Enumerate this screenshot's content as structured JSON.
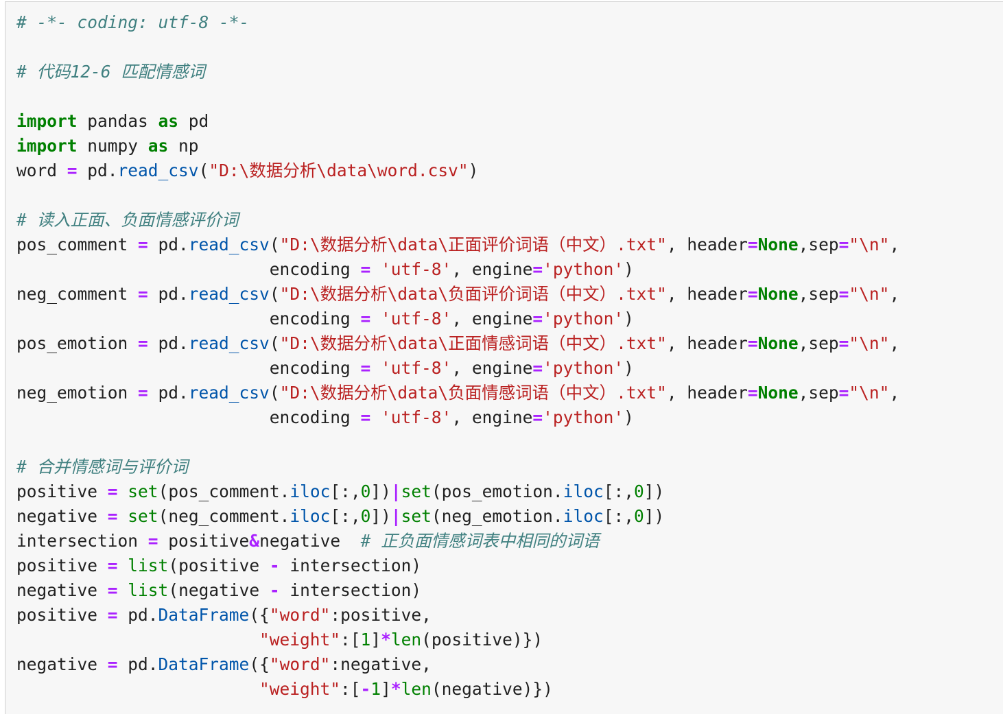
{
  "cell": {
    "lines": [
      [
        [
          "c",
          "# -*- coding: utf-8 -*-"
        ]
      ],
      [],
      [
        [
          "c",
          "# 代码12-6 匹配情感词"
        ]
      ],
      [],
      [
        [
          "k",
          "import"
        ],
        [
          "t",
          " pandas "
        ],
        [
          "k",
          "as"
        ],
        [
          "t",
          " pd"
        ]
      ],
      [
        [
          "k",
          "import"
        ],
        [
          "t",
          " numpy "
        ],
        [
          "k",
          "as"
        ],
        [
          "t",
          " np"
        ]
      ],
      [
        [
          "t",
          "word "
        ],
        [
          "o",
          "="
        ],
        [
          "t",
          " pd."
        ],
        [
          "f",
          "read_csv"
        ],
        [
          "t",
          "("
        ],
        [
          "s",
          "\"D:\\数据分析\\data\\word.csv\""
        ],
        [
          "t",
          ")"
        ]
      ],
      [],
      [
        [
          "c",
          "# 读入正面、负面情感评价词"
        ]
      ],
      [
        [
          "t",
          "pos_comment "
        ],
        [
          "o",
          "="
        ],
        [
          "t",
          " pd."
        ],
        [
          "f",
          "read_csv"
        ],
        [
          "t",
          "("
        ],
        [
          "s",
          "\"D:\\数据分析\\data\\正面评价词语（中文）.txt\""
        ],
        [
          "t",
          ", header"
        ],
        [
          "o",
          "="
        ],
        [
          "k",
          "None"
        ],
        [
          "t",
          ",sep"
        ],
        [
          "o",
          "="
        ],
        [
          "s",
          "\"\\n\""
        ],
        [
          "t",
          ","
        ]
      ],
      [
        [
          "t",
          "                         encoding "
        ],
        [
          "o",
          "="
        ],
        [
          "t",
          " "
        ],
        [
          "s",
          "'utf-8'"
        ],
        [
          "t",
          ", engine"
        ],
        [
          "o",
          "="
        ],
        [
          "s",
          "'python'"
        ],
        [
          "t",
          ")"
        ]
      ],
      [
        [
          "t",
          "neg_comment "
        ],
        [
          "o",
          "="
        ],
        [
          "t",
          " pd."
        ],
        [
          "f",
          "read_csv"
        ],
        [
          "t",
          "("
        ],
        [
          "s",
          "\"D:\\数据分析\\data\\负面评价词语（中文）.txt\""
        ],
        [
          "t",
          ", header"
        ],
        [
          "o",
          "="
        ],
        [
          "k",
          "None"
        ],
        [
          "t",
          ",sep"
        ],
        [
          "o",
          "="
        ],
        [
          "s",
          "\"\\n\""
        ],
        [
          "t",
          ","
        ]
      ],
      [
        [
          "t",
          "                         encoding "
        ],
        [
          "o",
          "="
        ],
        [
          "t",
          " "
        ],
        [
          "s",
          "'utf-8'"
        ],
        [
          "t",
          ", engine"
        ],
        [
          "o",
          "="
        ],
        [
          "s",
          "'python'"
        ],
        [
          "t",
          ")"
        ]
      ],
      [
        [
          "t",
          "pos_emotion "
        ],
        [
          "o",
          "="
        ],
        [
          "t",
          " pd."
        ],
        [
          "f",
          "read_csv"
        ],
        [
          "t",
          "("
        ],
        [
          "s",
          "\"D:\\数据分析\\data\\正面情感词语（中文）.txt\""
        ],
        [
          "t",
          ", header"
        ],
        [
          "o",
          "="
        ],
        [
          "k",
          "None"
        ],
        [
          "t",
          ",sep"
        ],
        [
          "o",
          "="
        ],
        [
          "s",
          "\"\\n\""
        ],
        [
          "t",
          ","
        ]
      ],
      [
        [
          "t",
          "                         encoding "
        ],
        [
          "o",
          "="
        ],
        [
          "t",
          " "
        ],
        [
          "s",
          "'utf-8'"
        ],
        [
          "t",
          ", engine"
        ],
        [
          "o",
          "="
        ],
        [
          "s",
          "'python'"
        ],
        [
          "t",
          ")"
        ]
      ],
      [
        [
          "t",
          "neg_emotion "
        ],
        [
          "o",
          "="
        ],
        [
          "t",
          " pd."
        ],
        [
          "f",
          "read_csv"
        ],
        [
          "t",
          "("
        ],
        [
          "s",
          "\"D:\\数据分析\\data\\负面情感词语（中文）.txt\""
        ],
        [
          "t",
          ", header"
        ],
        [
          "o",
          "="
        ],
        [
          "k",
          "None"
        ],
        [
          "t",
          ",sep"
        ],
        [
          "o",
          "="
        ],
        [
          "s",
          "\"\\n\""
        ],
        [
          "t",
          ","
        ]
      ],
      [
        [
          "t",
          "                         encoding "
        ],
        [
          "o",
          "="
        ],
        [
          "t",
          " "
        ],
        [
          "s",
          "'utf-8'"
        ],
        [
          "t",
          ", engine"
        ],
        [
          "o",
          "="
        ],
        [
          "s",
          "'python'"
        ],
        [
          "t",
          ")"
        ]
      ],
      [],
      [
        [
          "c",
          "# 合并情感词与评价词"
        ]
      ],
      [
        [
          "t",
          "positive "
        ],
        [
          "o",
          "="
        ],
        [
          "t",
          " "
        ],
        [
          "b",
          "set"
        ],
        [
          "t",
          "(pos_comment."
        ],
        [
          "f",
          "iloc"
        ],
        [
          "t",
          "[:,"
        ],
        [
          "n",
          "0"
        ],
        [
          "t",
          "])"
        ],
        [
          "o",
          "|"
        ],
        [
          "b",
          "set"
        ],
        [
          "t",
          "(pos_emotion."
        ],
        [
          "f",
          "iloc"
        ],
        [
          "t",
          "[:,"
        ],
        [
          "n",
          "0"
        ],
        [
          "t",
          "])"
        ]
      ],
      [
        [
          "t",
          "negative "
        ],
        [
          "o",
          "="
        ],
        [
          "t",
          " "
        ],
        [
          "b",
          "set"
        ],
        [
          "t",
          "(neg_comment."
        ],
        [
          "f",
          "iloc"
        ],
        [
          "t",
          "[:,"
        ],
        [
          "n",
          "0"
        ],
        [
          "t",
          "])"
        ],
        [
          "o",
          "|"
        ],
        [
          "b",
          "set"
        ],
        [
          "t",
          "(neg_emotion."
        ],
        [
          "f",
          "iloc"
        ],
        [
          "t",
          "[:,"
        ],
        [
          "n",
          "0"
        ],
        [
          "t",
          "])"
        ]
      ],
      [
        [
          "t",
          "intersection "
        ],
        [
          "o",
          "="
        ],
        [
          "t",
          " positive"
        ],
        [
          "o",
          "&"
        ],
        [
          "t",
          "negative  "
        ],
        [
          "c",
          "# 正负面情感词表中相同的词语"
        ]
      ],
      [
        [
          "t",
          "positive "
        ],
        [
          "o",
          "="
        ],
        [
          "t",
          " "
        ],
        [
          "b",
          "list"
        ],
        [
          "t",
          "(positive "
        ],
        [
          "o",
          "-"
        ],
        [
          "t",
          " intersection)"
        ]
      ],
      [
        [
          "t",
          "negative "
        ],
        [
          "o",
          "="
        ],
        [
          "t",
          " "
        ],
        [
          "b",
          "list"
        ],
        [
          "t",
          "(negative "
        ],
        [
          "o",
          "-"
        ],
        [
          "t",
          " intersection)"
        ]
      ],
      [
        [
          "t",
          "positive "
        ],
        [
          "o",
          "="
        ],
        [
          "t",
          " pd."
        ],
        [
          "f",
          "DataFrame"
        ],
        [
          "t",
          "({"
        ],
        [
          "s",
          "\"word\""
        ],
        [
          "t",
          ":positive,"
        ]
      ],
      [
        [
          "t",
          "                        "
        ],
        [
          "s",
          "\"weight\""
        ],
        [
          "t",
          ":["
        ],
        [
          "n",
          "1"
        ],
        [
          "t",
          "]"
        ],
        [
          "o",
          "*"
        ],
        [
          "b",
          "len"
        ],
        [
          "t",
          "(positive)})"
        ]
      ],
      [
        [
          "t",
          "negative "
        ],
        [
          "o",
          "="
        ],
        [
          "t",
          " pd."
        ],
        [
          "f",
          "DataFrame"
        ],
        [
          "t",
          "({"
        ],
        [
          "s",
          "\"word\""
        ],
        [
          "t",
          ":negative,"
        ]
      ],
      [
        [
          "t",
          "                        "
        ],
        [
          "s",
          "\"weight\""
        ],
        [
          "t",
          ":["
        ],
        [
          "o",
          "-"
        ],
        [
          "n",
          "1"
        ],
        [
          "t",
          "]"
        ],
        [
          "o",
          "*"
        ],
        [
          "b",
          "len"
        ],
        [
          "t",
          "(negative)})"
        ]
      ]
    ]
  }
}
